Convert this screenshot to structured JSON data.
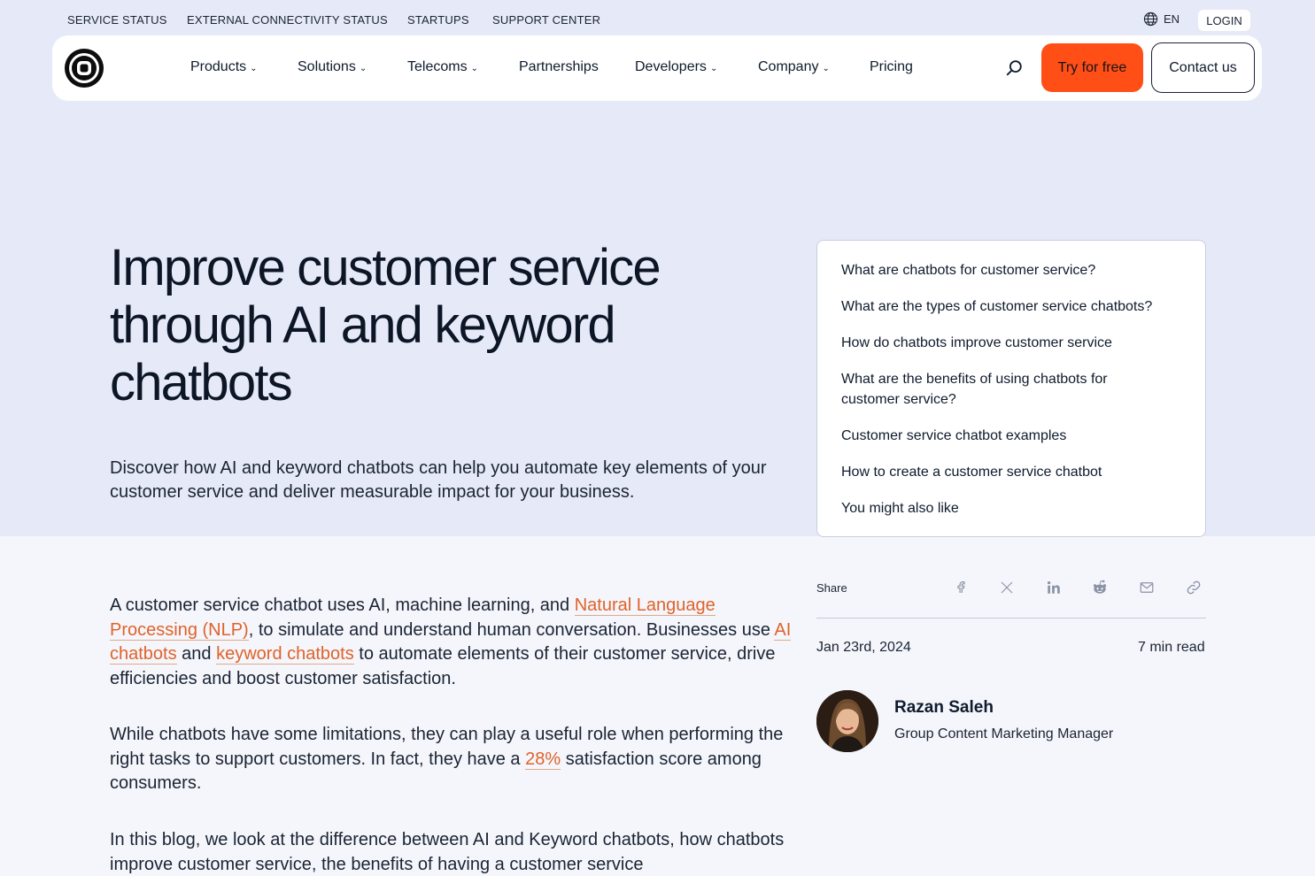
{
  "utility_nav": {
    "links": [
      "SERVICE STATUS",
      "EXTERNAL CONNECTIVITY STATUS",
      "STARTUPS",
      "SUPPORT CENTER"
    ],
    "language": "EN",
    "login": "LOGIN"
  },
  "nav": {
    "items": [
      {
        "label": "Products",
        "has_dropdown": true
      },
      {
        "label": "Solutions",
        "has_dropdown": true
      },
      {
        "label": "Telecoms",
        "has_dropdown": true
      },
      {
        "label": "Partnerships",
        "has_dropdown": false
      },
      {
        "label": "Developers",
        "has_dropdown": true
      },
      {
        "label": "Company",
        "has_dropdown": true
      },
      {
        "label": "Pricing",
        "has_dropdown": false
      }
    ],
    "chevron": "⌄",
    "try_free": "Try for free",
    "contact": "Contact us"
  },
  "hero": {
    "title": "Improve customer service through AI and keyword chatbots",
    "subtitle": "Discover how AI and keyword chatbots can help you automate key elements of your customer service and deliver measurable impact for your business."
  },
  "toc": {
    "items": [
      "What are chatbots for customer service?",
      "What are the types of customer service chatbots?",
      "How do chatbots improve customer service",
      "What are the benefits of using chatbots for customer service?",
      "Customer service chatbot examples",
      "How to create a customer service chatbot",
      "You might also like"
    ]
  },
  "article": {
    "p1": {
      "t1": "A customer service chatbot uses AI, machine learning, and ",
      "link1": "Natural Language Processing (NLP)",
      "t2": ", to simulate and understand human conversation. Businesses use ",
      "link2": "AI chatbots",
      "t3": " and ",
      "link3": "keyword chatbots",
      "t4": " to automate elements of their customer service, drive efficiencies and boost customer satisfaction."
    },
    "p2": {
      "t1": "While chatbots have some limitations, they can play a useful role when performing the right tasks to support customers. In fact, they have a ",
      "link1": "28%",
      "t2": " satisfaction score among consumers."
    },
    "p3": "In this blog, we look at the difference between AI and Keyword chatbots, how chatbots improve customer service, the benefits of having a customer service"
  },
  "sidebar": {
    "share_label": "Share",
    "share_icons": [
      "facebook-icon",
      "x-icon",
      "linkedin-icon",
      "reddit-icon",
      "mail-icon",
      "link-icon"
    ],
    "date": "Jan 23rd, 2024",
    "read_time": "7 min read",
    "author_name": "Razan Saleh",
    "author_role": "Group Content Marketing Manager"
  },
  "colors": {
    "accent": "#ff4f17",
    "link": "#e0622a",
    "hero_bg": "#e6eaf8"
  }
}
